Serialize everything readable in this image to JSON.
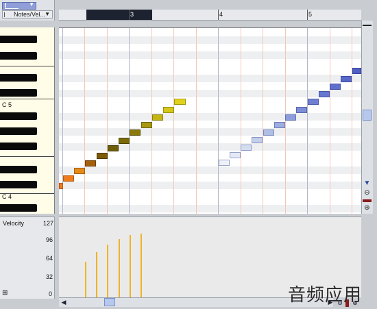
{
  "toolbar": {
    "mode_dropdown_label": "Notes/Vel..."
  },
  "timeline": {
    "bar_labels": [
      "3",
      "4",
      "5"
    ]
  },
  "keyboard": {
    "octave_labels": [
      "C 5",
      "C 4"
    ]
  },
  "velocity_lane": {
    "title": "Velocity",
    "scale_labels": [
      "127",
      "96",
      "64",
      "32",
      "0"
    ],
    "expand_symbol": "⊞"
  },
  "colors": {
    "accent_purple": "#8f9ed8",
    "velocity_bar": "#f0b323",
    "selection": "#1c2230",
    "zoom_marker": "#8a1b1b"
  },
  "icons": {
    "tool": "pencil-tool-icon",
    "zoom_out": "zoom-out-icon",
    "zoom_in": "zoom-in-icon",
    "scroll_left": "arrow-left-icon",
    "scroll_right": "arrow-right-icon"
  },
  "watermark": "音频应用"
}
